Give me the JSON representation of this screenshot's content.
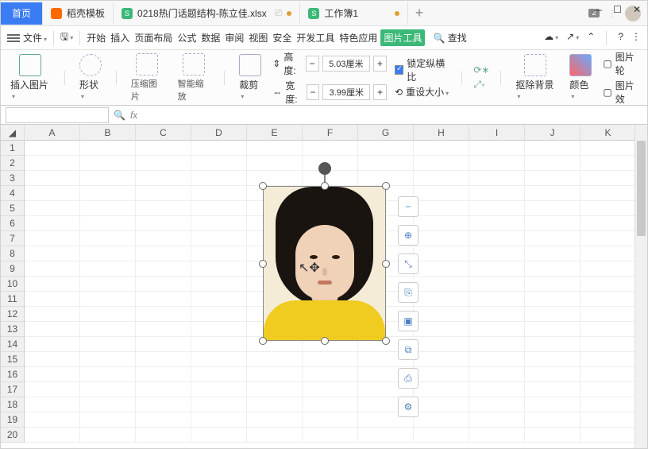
{
  "tabs": {
    "home": "首页",
    "t1": "稻壳模板",
    "t2": "0218热门话题结构-陈立佳.xlsx",
    "t3": "工作簿1"
  },
  "menu": {
    "file": "文件",
    "m1": "开始",
    "m2": "插入",
    "m3": "页面布局",
    "m4": "公式",
    "m5": "数据",
    "m6": "审阅",
    "m7": "视图",
    "m8": "安全",
    "m9": "开发工具",
    "m10": "特色应用",
    "m11": "图片工具",
    "find": "查找"
  },
  "ribbon": {
    "insert": "插入图片",
    "shape": "形状",
    "compress": "压缩图片",
    "smart": "智能缩放",
    "crop": "裁剪",
    "height": "高度:",
    "width": "宽度:",
    "hval": "5.03厘米",
    "wval": "3.99厘米",
    "lock": "锁定纵横比",
    "reset": "重设大小",
    "removebg": "抠除背景",
    "color": "颜色",
    "picfx": "图片轮",
    "picfx2": "图片效"
  },
  "cols": [
    "A",
    "B",
    "C",
    "D",
    "E",
    "F",
    "G",
    "H",
    "I",
    "J",
    "K"
  ],
  "rows": [
    "1",
    "2",
    "3",
    "4",
    "5",
    "6",
    "7",
    "8",
    "9",
    "10",
    "11",
    "12",
    "13",
    "14",
    "15",
    "16",
    "17",
    "18",
    "19",
    "20"
  ],
  "badge": "2"
}
